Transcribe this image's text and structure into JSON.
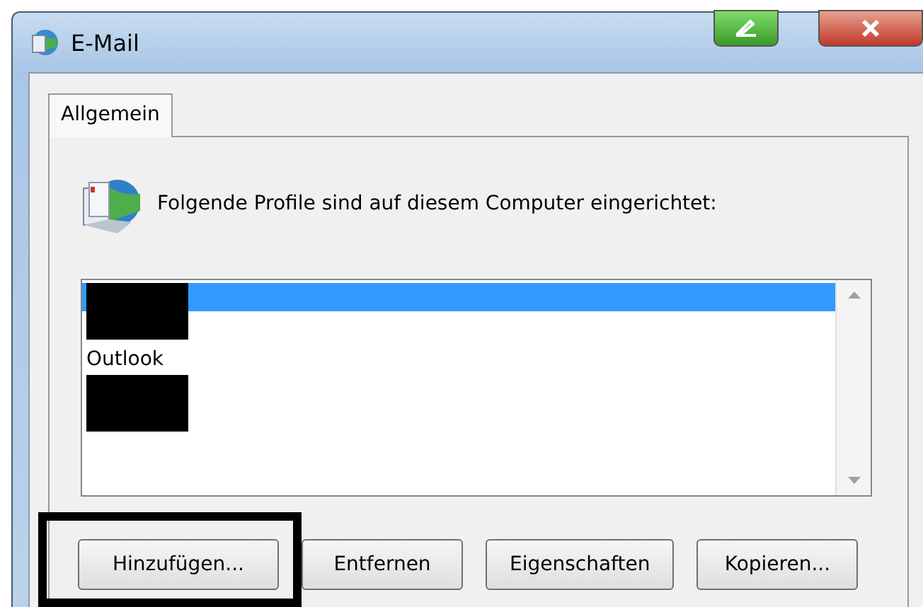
{
  "window": {
    "title": "E-Mail"
  },
  "tabs": [
    {
      "label": "Allgemein",
      "selected": true
    }
  ],
  "heading": "Folgende Profile sind auf diesem Computer eingerichtet:",
  "profiles": [
    {
      "kind": "redacted",
      "selected": true
    },
    {
      "kind": "text",
      "label": "Outlook",
      "selected": false
    },
    {
      "kind": "redacted",
      "selected": false
    }
  ],
  "buttons": [
    {
      "label": "Hinzufügen...",
      "highlighted": true
    },
    {
      "label": "Entfernen",
      "highlighted": false
    },
    {
      "label": "Eigenschaften",
      "highlighted": false
    },
    {
      "label": "Kopieren...",
      "highlighted": false
    }
  ]
}
